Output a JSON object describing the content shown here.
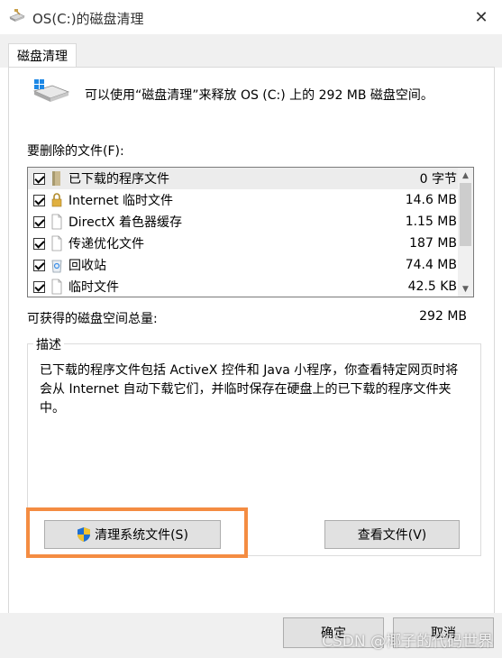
{
  "window": {
    "title": "OS(C:)的磁盘清理",
    "close_glyph": "✕"
  },
  "tab": {
    "label": "磁盘清理"
  },
  "summary": "可以使用“磁盘清理”来释放 OS (C:) 上的 292 MB 磁盘空间。",
  "files_label": "要删除的文件(F):",
  "file_list": [
    {
      "name": "已下载的程序文件",
      "size": "0 字节",
      "checked": true,
      "selected": true,
      "icon": "folder-icon"
    },
    {
      "name": "Internet 临时文件",
      "size": "14.6 MB",
      "checked": true,
      "selected": false,
      "icon": "lock-icon"
    },
    {
      "name": "DirectX 着色器缓存",
      "size": "1.15 MB",
      "checked": true,
      "selected": false,
      "icon": "file-icon"
    },
    {
      "name": "传递优化文件",
      "size": "187 MB",
      "checked": true,
      "selected": false,
      "icon": "file-icon"
    },
    {
      "name": "回收站",
      "size": "74.4 MB",
      "checked": true,
      "selected": false,
      "icon": "recycle-bin-icon"
    },
    {
      "name": "临时文件",
      "size": "42.5 KB",
      "checked": true,
      "selected": false,
      "icon": "file-icon"
    }
  ],
  "gain": {
    "label": "可获得的磁盘空间总量:",
    "value": "292 MB"
  },
  "description": {
    "title": "描述",
    "text": "已下载的程序文件包括 ActiveX 控件和 Java 小程序，你查看特定网页时将会从 Internet 自动下载它们，并临时保存在硬盘上的已下载的程序文件夹中。"
  },
  "buttons": {
    "clean_system": "清理系统文件(S)",
    "view_files": "查看文件(V)",
    "ok": "确定",
    "cancel": "取消"
  },
  "watermark": "CSDN @椰子的代码世界",
  "colors": {
    "highlight": "#f48c42",
    "button_bg": "#e1e1e1",
    "selected_row": "#ececec"
  }
}
